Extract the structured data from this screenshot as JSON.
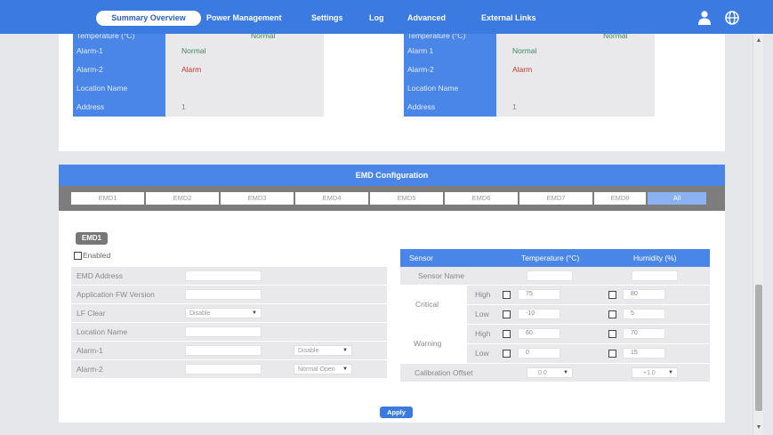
{
  "nav": {
    "items": [
      "Summary Overview",
      "Power Management",
      "Settings",
      "Log",
      "Advanced",
      "External Links"
    ],
    "active": "Summary Overview",
    "user_icon": "user-icon",
    "globe_icon": "globe-icon"
  },
  "status_left": [
    {
      "label": "Temperature (°C)",
      "value": "Normal",
      "status": "normal"
    },
    {
      "label": "Alarm-1",
      "value": "Normal",
      "status": "normal"
    },
    {
      "label": "Alarm-2",
      "value": "Alarm",
      "status": "alarm"
    },
    {
      "label": "Location Name",
      "value": "",
      "status": "plain"
    },
    {
      "label": "Address",
      "value": "1",
      "status": "plain"
    }
  ],
  "status_right": [
    {
      "label": "Temperature (°C)",
      "value": "Normal",
      "status": "normal"
    },
    {
      "label": "Alarm 1",
      "value": "Normal",
      "status": "normal"
    },
    {
      "label": "Alarm-2",
      "value": "Alarm",
      "status": "alarm"
    },
    {
      "label": "Location Name",
      "value": "",
      "status": "plain"
    },
    {
      "label": "Address",
      "value": "1",
      "status": "plain"
    }
  ],
  "config": {
    "title": "EMD Configuration",
    "tabs": [
      "EMD1",
      "EMD2",
      "EMD3",
      "EMD4",
      "EMD5",
      "EMD6",
      "EMD7",
      "EMD8",
      "All"
    ],
    "active_tab": 8,
    "badge": "EMD1",
    "enabled_label": "Enabled",
    "fields": {
      "emd_address": "EMD Address",
      "app_fw": "Application FW Version",
      "lf_clear": "LF Clear",
      "lf_clear_value": "Disable",
      "location_name": "Location Name",
      "alarm1": "Alarm-1",
      "alarm1_value": "Disable",
      "alarm2": "Alarm-2",
      "alarm2_value": "Normal Open"
    },
    "sensor": {
      "head_sensor": "Sensor",
      "head_temp": "Temperature (°C)",
      "head_hum": "Humidity (%)",
      "sensor_name": "Sensor Name",
      "critical": "Critical",
      "warning": "Warning",
      "high": "High",
      "low": "Low",
      "crit_high_temp": "75",
      "crit_high_hum": "80",
      "crit_low_temp": "-10",
      "crit_low_hum": "5",
      "warn_high_temp": "60",
      "warn_high_hum": "70",
      "warn_low_temp": "0",
      "warn_low_hum": "15",
      "calibration": "Calibration Offset",
      "cal_temp": "0.0",
      "cal_hum": "+1.0"
    },
    "apply": "Apply"
  }
}
